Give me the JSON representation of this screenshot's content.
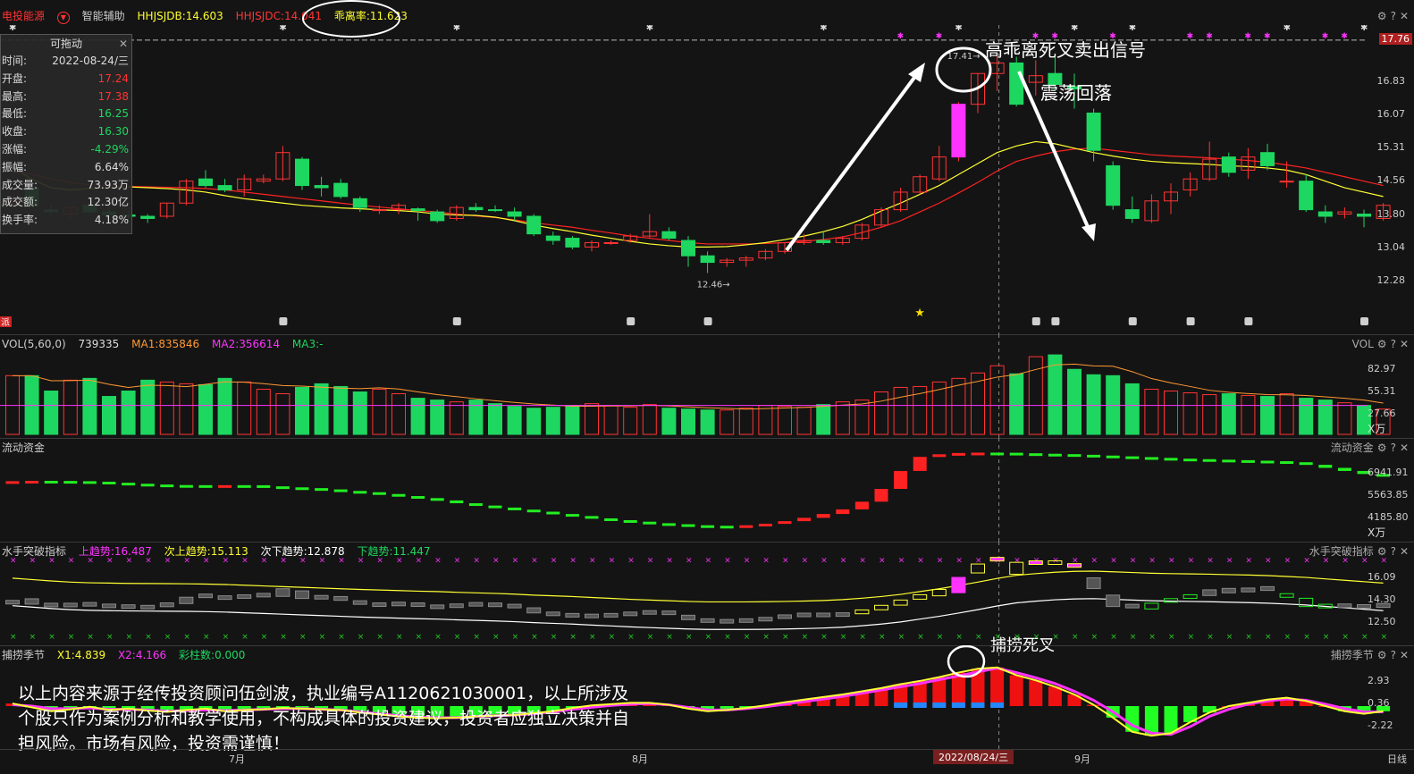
{
  "colors": {
    "up": "#ff3333",
    "down": "#1ed760",
    "ma5": "#ffff33",
    "ma10": "#ff2222",
    "magenta": "#ff33ff",
    "orange": "#ff9933",
    "accent": "#ffff00"
  },
  "header": {
    "stock": "电投能源",
    "assist": "智能辅助",
    "hhjsjdb": "HHJSJDB:14.603",
    "hhjsjdc": "HHJSJDC:14.041",
    "guai": "乖离率:11.623",
    "icons": [
      "settings-icon",
      "help-icon",
      "close-icon"
    ]
  },
  "info": {
    "title": "可拖动",
    "rows": [
      {
        "k": "时间:",
        "v": "2022-08-24/三",
        "c": "#ddd"
      },
      {
        "k": "开盘:",
        "v": "17.24",
        "c": "#ff3333"
      },
      {
        "k": "最高:",
        "v": "17.38",
        "c": "#ff3333"
      },
      {
        "k": "最低:",
        "v": "16.25",
        "c": "#1ed760"
      },
      {
        "k": "收盘:",
        "v": "16.30",
        "c": "#1ed760"
      },
      {
        "k": "涨幅:",
        "v": "-4.29%",
        "c": "#1ed760"
      },
      {
        "k": "振幅:",
        "v": "6.64%",
        "c": "#ddd"
      },
      {
        "k": "成交量:",
        "v": "73.93万",
        "c": "#ddd"
      },
      {
        "k": "成交额:",
        "v": "12.30亿",
        "c": "#ddd"
      },
      {
        "k": "换手率:",
        "v": "4.18%",
        "c": "#ddd"
      }
    ]
  },
  "main": {
    "yticks": [
      "16.83",
      "16.07",
      "15.31",
      "14.56",
      "13.80",
      "13.04",
      "12.28"
    ],
    "ylabel_top": "17.76",
    "hi_label": "17.41",
    "lo_label": "12.46",
    "pai": "派"
  },
  "annotations": {
    "sell": "高乖离死叉卖出信号",
    "fall": "震荡回落",
    "death": "捕捞死叉"
  },
  "vol": {
    "header": [
      "VOL(5,60,0)",
      "739335",
      "MA1:835846",
      "MA2:356614",
      "MA3:-"
    ],
    "name": "VOL",
    "yticks": [
      "82.97",
      "55.31",
      "27.66"
    ],
    "unit": "X万"
  },
  "flow": {
    "name": "流动资金",
    "yticks": [
      "6941.91",
      "5563.85",
      "4185.80"
    ],
    "unit": "X万"
  },
  "sailor": {
    "name": "水手突破指标",
    "header": [
      "上趋势:16.487",
      "次上趋势:15.113",
      "次下趋势:12.878",
      "下趋势:11.447"
    ],
    "yticks": [
      "16.09",
      "14.30",
      "12.50"
    ]
  },
  "catch": {
    "name": "捕捞季节",
    "header": [
      "X1:4.839",
      "X2:4.166",
      "彩柱数:0.000"
    ],
    "yticks": [
      "2.93",
      "0.36",
      "-2.22"
    ]
  },
  "xaxis": {
    "months": [
      "7月",
      "8月",
      "9月"
    ],
    "cursor": "2022/08/24/三",
    "period": "日线"
  },
  "disclaimer": "以上内容来源于经传投资顾问伍剑波，执业编号A1120621030001，以上所涉及个股只作为案例分析和教学使用，不构成具体的投资建议，投资者应独立决策并自担风险。市场有风险，投资需谨慎！",
  "chart_data": {
    "type": "candlestick",
    "ylim": [
      12.0,
      17.9
    ],
    "candles": [
      [
        14.05,
        14.25,
        13.95,
        14.1
      ],
      [
        14.4,
        14.6,
        13.95,
        13.98
      ],
      [
        13.9,
        14.0,
        13.75,
        13.85
      ],
      [
        13.8,
        14.0,
        13.7,
        13.95
      ],
      [
        14.0,
        14.1,
        13.8,
        13.85
      ],
      [
        13.85,
        14.0,
        13.7,
        13.78
      ],
      [
        13.78,
        13.9,
        13.6,
        13.75
      ],
      [
        13.75,
        13.8,
        13.6,
        13.7
      ],
      [
        13.75,
        14.05,
        13.7,
        14.05
      ],
      [
        14.05,
        14.6,
        14.0,
        14.55
      ],
      [
        14.6,
        14.8,
        14.4,
        14.45
      ],
      [
        14.45,
        14.6,
        14.3,
        14.35
      ],
      [
        14.35,
        14.7,
        14.2,
        14.6
      ],
      [
        14.55,
        14.7,
        14.5,
        14.6
      ],
      [
        14.6,
        15.35,
        14.55,
        15.2
      ],
      [
        15.05,
        15.1,
        14.35,
        14.45
      ],
      [
        14.45,
        14.65,
        14.2,
        14.4
      ],
      [
        14.5,
        14.6,
        14.15,
        14.2
      ],
      [
        14.15,
        14.2,
        13.85,
        13.95
      ],
      [
        13.9,
        14.0,
        13.8,
        13.9
      ],
      [
        13.9,
        14.05,
        13.8,
        14.0
      ],
      [
        13.92,
        13.95,
        13.65,
        13.88
      ],
      [
        13.85,
        13.9,
        13.6,
        13.65
      ],
      [
        13.7,
        14.0,
        13.65,
        13.95
      ],
      [
        13.95,
        14.05,
        13.85,
        13.9
      ],
      [
        13.9,
        14.0,
        13.85,
        13.88
      ],
      [
        13.85,
        13.95,
        13.65,
        13.75
      ],
      [
        13.75,
        13.8,
        13.3,
        13.35
      ],
      [
        13.3,
        13.4,
        13.1,
        13.2
      ],
      [
        13.25,
        13.3,
        13.0,
        13.05
      ],
      [
        13.05,
        13.2,
        12.95,
        13.15
      ],
      [
        13.15,
        13.2,
        13.1,
        13.15
      ],
      [
        13.2,
        13.35,
        13.15,
        13.3
      ],
      [
        13.3,
        13.8,
        13.25,
        13.4
      ],
      [
        13.4,
        13.5,
        13.2,
        13.25
      ],
      [
        13.2,
        13.3,
        12.6,
        12.85
      ],
      [
        12.85,
        12.95,
        12.46,
        12.7
      ],
      [
        12.7,
        12.8,
        12.6,
        12.75
      ],
      [
        12.75,
        12.85,
        12.6,
        12.8
      ],
      [
        12.8,
        13.0,
        12.75,
        12.95
      ],
      [
        12.95,
        13.15,
        12.9,
        13.15
      ],
      [
        13.15,
        13.35,
        13.1,
        13.2
      ],
      [
        13.2,
        13.4,
        13.1,
        13.15
      ],
      [
        13.15,
        13.3,
        13.1,
        13.25
      ],
      [
        13.25,
        13.6,
        13.2,
        13.55
      ],
      [
        13.55,
        13.95,
        13.5,
        13.9
      ],
      [
        13.9,
        14.4,
        13.85,
        14.3
      ],
      [
        14.3,
        14.7,
        14.25,
        14.65
      ],
      [
        14.6,
        15.35,
        14.55,
        15.1
      ],
      [
        15.1,
        16.35,
        15.0,
        16.3
      ],
      [
        16.3,
        17.0,
        16.1,
        17.0
      ],
      [
        17.0,
        17.41,
        16.6,
        17.24
      ],
      [
        17.24,
        17.38,
        16.25,
        16.3
      ],
      [
        16.8,
        17.3,
        16.5,
        16.95
      ],
      [
        17.0,
        17.4,
        16.6,
        16.75
      ],
      [
        16.7,
        17.0,
        16.2,
        16.65
      ],
      [
        16.1,
        16.2,
        15.0,
        15.25
      ],
      [
        14.9,
        15.0,
        13.9,
        14.0
      ],
      [
        13.9,
        14.2,
        13.6,
        13.7
      ],
      [
        13.65,
        14.25,
        13.6,
        14.1
      ],
      [
        14.1,
        14.5,
        13.8,
        14.3
      ],
      [
        14.35,
        14.75,
        14.2,
        14.6
      ],
      [
        14.6,
        15.45,
        14.55,
        15.05
      ],
      [
        15.1,
        15.2,
        14.65,
        14.75
      ],
      [
        14.8,
        15.3,
        14.6,
        15.1
      ],
      [
        15.2,
        15.4,
        14.8,
        14.9
      ],
      [
        14.55,
        15.0,
        14.4,
        14.55
      ],
      [
        14.55,
        14.7,
        13.85,
        13.9
      ],
      [
        13.85,
        14.0,
        13.6,
        13.75
      ],
      [
        13.8,
        13.95,
        13.7,
        13.85
      ],
      [
        13.8,
        13.9,
        13.5,
        13.75
      ],
      [
        13.7,
        14.05,
        13.65,
        14.0
      ]
    ],
    "ma5": [
      14.85,
      14.6,
      14.4,
      14.35,
      14.38,
      14.4,
      14.42,
      14.4,
      14.38,
      14.35,
      14.3,
      14.22,
      14.15,
      14.1,
      14.05,
      14.0,
      13.97,
      13.94,
      13.92,
      13.9,
      13.88,
      13.85,
      13.8,
      13.78,
      13.77,
      13.73,
      13.65,
      13.55,
      13.47,
      13.4,
      13.32,
      13.25,
      13.18,
      13.12,
      13.08,
      13.05,
      13.05,
      13.06,
      13.1,
      13.15,
      13.22,
      13.3,
      13.4,
      13.52,
      13.68,
      13.87,
      14.05,
      14.25,
      14.45,
      14.7,
      14.95,
      15.2,
      15.35,
      15.45,
      15.4,
      15.3,
      15.2,
      15.12,
      15.05,
      15.0,
      14.97,
      14.95,
      14.93,
      14.9,
      14.88,
      14.85,
      14.8,
      14.7,
      14.55,
      14.4,
      14.3,
      14.2
    ],
    "ma10": [
      14.8,
      14.7,
      14.6,
      14.52,
      14.47,
      14.45,
      14.43,
      14.42,
      14.41,
      14.4,
      14.38,
      14.35,
      14.3,
      14.25,
      14.2,
      14.15,
      14.1,
      14.05,
      14.0,
      13.96,
      13.92,
      13.88,
      13.85,
      13.8,
      13.76,
      13.72,
      13.67,
      13.6,
      13.55,
      13.5,
      13.43,
      13.37,
      13.3,
      13.25,
      13.2,
      13.15,
      13.12,
      13.12,
      13.12,
      13.13,
      13.15,
      13.18,
      13.22,
      13.28,
      13.38,
      13.5,
      13.65,
      13.85,
      14.05,
      14.28,
      14.52,
      14.78,
      15.0,
      15.12,
      15.22,
      15.28,
      15.3,
      15.25,
      15.2,
      15.15,
      15.12,
      15.1,
      15.08,
      15.05,
      15.02,
      14.98,
      14.92,
      14.85,
      14.75,
      14.65,
      14.55,
      14.45
    ],
    "volume": [
      65,
      65,
      48,
      60,
      62,
      42,
      48,
      60,
      58,
      56,
      55,
      62,
      58,
      50,
      45,
      52,
      56,
      53,
      47,
      50,
      45,
      40,
      38,
      36,
      38,
      34,
      31,
      29,
      30,
      32,
      34,
      32,
      30,
      33,
      29,
      28,
      27,
      27,
      29,
      32,
      31,
      30,
      33,
      36,
      38,
      47,
      52,
      53,
      58,
      62,
      68,
      76,
      67,
      86,
      88,
      72,
      66,
      65,
      56,
      50,
      48,
      46,
      44,
      45,
      43,
      42,
      45,
      40,
      38,
      35,
      32,
      28
    ],
    "flow": [
      5900,
      5915,
      5910,
      5900,
      5880,
      5840,
      5800,
      5770,
      5750,
      5745,
      5740,
      5745,
      5742,
      5700,
      5660,
      5630,
      5580,
      5520,
      5470,
      5400,
      5320,
      5240,
      5150,
      5040,
      4950,
      4870,
      4790,
      4710,
      4620,
      4540,
      4450,
      4380,
      4320,
      4260,
      4220,
      4180,
      4160,
      4150,
      4180,
      4240,
      4340,
      4470,
      4620,
      4800,
      5100,
      5600,
      6300,
      6850,
      6950,
      7000,
      7015,
      7010,
      6990,
      6970,
      6955,
      6930,
      6900,
      6870,
      6840,
      6810,
      6780,
      6760,
      6740,
      6720,
      6700,
      6680,
      6640,
      6540,
      6420,
      6300,
      6180,
      6080
    ],
    "catch_x1": [
      0.4,
      -0.2,
      -0.8,
      -0.5,
      -0.1,
      -0.6,
      -0.4,
      -0.7,
      -0.9,
      -0.6,
      -0.4,
      -0.8,
      -0.6,
      -0.5,
      -0.3,
      -0.4,
      -0.5,
      -0.6,
      -1.0,
      -1.3,
      -1.6,
      -1.8,
      -1.9,
      -1.8,
      -1.6,
      -1.5,
      -1.4,
      -1.1,
      -0.8,
      -0.3,
      0.1,
      0.3,
      0.5,
      0.5,
      0.2,
      -0.4,
      -0.8,
      -0.6,
      -0.3,
      0.1,
      0.6,
      1.0,
      1.4,
      1.8,
      2.3,
      2.8,
      3.4,
      3.9,
      4.5,
      5.2,
      5.8,
      6.0,
      4.8,
      4.0,
      3.0,
      1.8,
      0.2,
      -1.8,
      -4.0,
      -4.6,
      -4.2,
      -2.5,
      -1.0,
      0.0,
      0.5,
      1.0,
      1.3,
      0.8,
      0.0,
      -0.8,
      -1.2,
      -0.8
    ],
    "catch_x2": [
      0.2,
      0.0,
      -0.4,
      -0.4,
      -0.3,
      -0.5,
      -0.5,
      -0.6,
      -0.8,
      -0.7,
      -0.6,
      -0.7,
      -0.6,
      -0.5,
      -0.4,
      -0.4,
      -0.5,
      -0.6,
      -0.9,
      -1.2,
      -1.5,
      -1.7,
      -1.8,
      -1.8,
      -1.6,
      -1.5,
      -1.4,
      -1.2,
      -0.9,
      -0.5,
      -0.2,
      0.1,
      0.3,
      0.4,
      0.2,
      -0.2,
      -0.6,
      -0.6,
      -0.4,
      -0.1,
      0.3,
      0.7,
      1.1,
      1.5,
      2.0,
      2.5,
      3.0,
      3.5,
      4.1,
      4.7,
      5.3,
      5.9,
      5.2,
      4.4,
      3.5,
      2.3,
      0.9,
      -0.9,
      -3.0,
      -4.2,
      -4.4,
      -3.2,
      -1.6,
      -0.5,
      0.3,
      0.8,
      1.1,
      0.9,
      0.3,
      -0.4,
      -0.9,
      -0.9
    ],
    "sailor_up": 16.487,
    "sailor_up2": 15.113,
    "sailor_down2": 12.878,
    "sailor_down": 11.447
  }
}
